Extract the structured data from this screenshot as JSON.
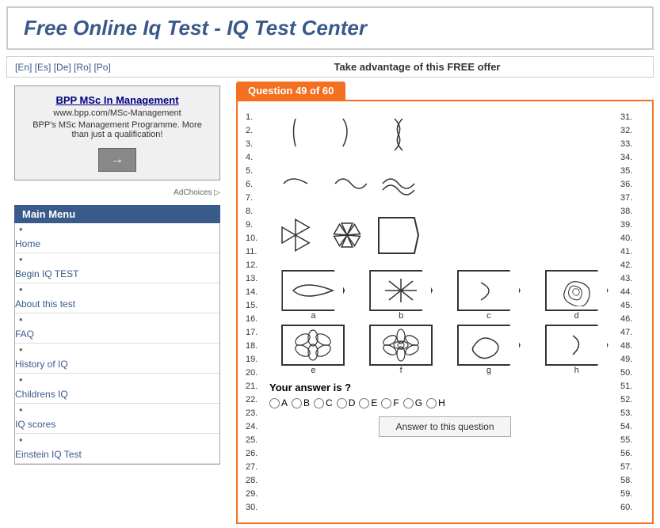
{
  "header": {
    "title": "Free Online Iq Test - IQ Test Center"
  },
  "navbar": {
    "languages": "[En] [Es] [De] [Ro] [Po]",
    "offer": "Take advantage of this FREE offer"
  },
  "sidebar": {
    "ad": {
      "title": "BPP MSc In Management",
      "url": "www.bpp.com/MSc-Management",
      "description": "BPP's MSc Management Programme. More than just a qualification!",
      "button_label": "→"
    },
    "ad_choices": "AdChoices ▷",
    "menu_header": "Main Menu",
    "menu_items": [
      {
        "label": "Home",
        "href": "#"
      },
      {
        "label": "Begin IQ TEST",
        "href": "#"
      },
      {
        "label": "About this test",
        "href": "#"
      },
      {
        "label": "FAQ",
        "href": "#"
      },
      {
        "label": "History of IQ",
        "href": "#"
      },
      {
        "label": "Childrens IQ",
        "href": "#"
      },
      {
        "label": "IQ scores",
        "href": "#"
      },
      {
        "label": "Einstein IQ Test",
        "href": "#"
      }
    ]
  },
  "question": {
    "header": "Question 49 of 60",
    "left_numbers": [
      "1.",
      "2.",
      "3.",
      "4.",
      "5.",
      "6.",
      "7.",
      "8.",
      "9.",
      "10.",
      "11.",
      "12.",
      "13.",
      "14.",
      "15.",
      "16.",
      "17.",
      "18.",
      "19.",
      "20.",
      "21.",
      "22.",
      "23.",
      "24.",
      "25.",
      "26.",
      "27.",
      "28.",
      "29.",
      "30."
    ],
    "right_numbers": [
      "31.",
      "32.",
      "33.",
      "34.",
      "35.",
      "36.",
      "37.",
      "38.",
      "39.",
      "40.",
      "41.",
      "42.",
      "43.",
      "44.",
      "45.",
      "46.",
      "47.",
      "48.",
      "49.",
      "50.",
      "51.",
      "52.",
      "53.",
      "54.",
      "55.",
      "56.",
      "57.",
      "58.",
      "59.",
      "60."
    ],
    "answer_label": "Your answer is ?",
    "answer_options": [
      "A",
      "B",
      "C",
      "D",
      "E",
      "F",
      "G",
      "H"
    ],
    "answer_button": "Answer to this question"
  }
}
